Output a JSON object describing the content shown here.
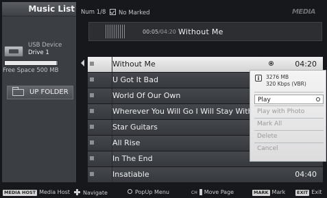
{
  "sidebar": {
    "title": "Music List",
    "device_label": "USB Device",
    "drive_label": "Drive 1",
    "free_space": "Free Space 500 MB",
    "free_space_used_fraction": 0.97,
    "up_folder": "UP FOLDER"
  },
  "header": {
    "num": "Num 1/8",
    "marked": "No Marked",
    "brand": "MEDIA"
  },
  "now_playing": {
    "elapsed": "00:05",
    "total": "/04:20",
    "title": "Without Me"
  },
  "tracks": [
    {
      "title": "Without Me",
      "duration": "04:20"
    },
    {
      "title": "U Got It Bad",
      "duration": ""
    },
    {
      "title": "World Of Our Own",
      "duration": ""
    },
    {
      "title": "Wherever You Will Go I Will Stay With",
      "duration": ""
    },
    {
      "title": "Star Guitars",
      "duration": ""
    },
    {
      "title": "All Rise",
      "duration": ""
    },
    {
      "title": "In The End",
      "duration": ""
    },
    {
      "title": "Insatiable",
      "duration": "04:40"
    }
  ],
  "popup": {
    "size": "3276 MB",
    "bitrate": "320 Kbps (VBR)",
    "items": [
      "Play",
      "Play with Photo",
      "Mark All",
      "Delete",
      "Cancel"
    ]
  },
  "bottom_bar": {
    "media_host_key": "MEDIA HOST",
    "media_host": "Media Host",
    "navigate": "Navigate",
    "popup_menu": "PopUp Menu",
    "ch_key": "CH",
    "move_page": "Move Page",
    "mark_key": "MARK",
    "mark": "Mark",
    "exit_key": "EXIT",
    "exit": "Exit"
  },
  "colors": {
    "background": "#16181b",
    "row": "#3e4146",
    "selected_row": "#e6e6e6",
    "popup": "#ececec"
  }
}
